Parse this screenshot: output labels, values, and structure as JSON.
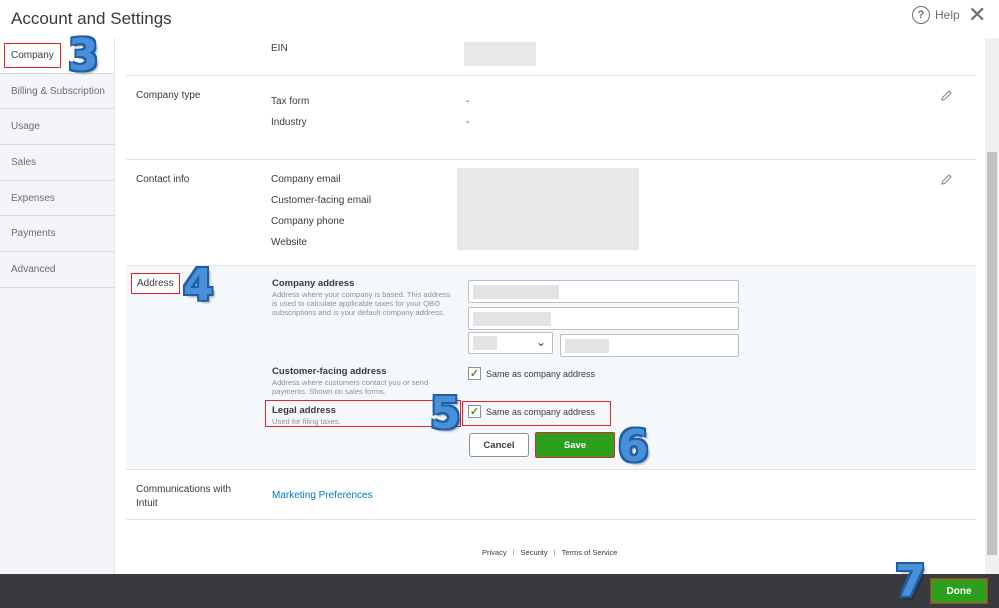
{
  "header": {
    "title": "Account and Settings",
    "help_label": "Help",
    "help_icon_glyph": "?",
    "close_glyph": "✕"
  },
  "sidebar": {
    "items": [
      {
        "label": "Company",
        "active": true
      },
      {
        "label": "Billing & Subscription"
      },
      {
        "label": "Usage"
      },
      {
        "label": "Sales"
      },
      {
        "label": "Expenses"
      },
      {
        "label": "Payments"
      },
      {
        "label": "Advanced"
      }
    ]
  },
  "company": {
    "ein_label": "EIN",
    "company_type": {
      "section_label": "Company type",
      "tax_form_label": "Tax form",
      "tax_form_value": "-",
      "industry_label": "Industry",
      "industry_value": "-"
    },
    "contact_info": {
      "section_label": "Contact info",
      "email_label": "Company email",
      "customer_email_label": "Customer-facing email",
      "phone_label": "Company phone",
      "website_label": "Website"
    },
    "address": {
      "section_label": "Address",
      "company_address_label": "Company address",
      "company_address_desc": "Address where your company is based. This address is used to calculate applicable taxes for your QBO subscriptions and is your default company address.",
      "customer_address_label": "Customer-facing address",
      "customer_address_desc": "Address where customers contact you or send payments. Shown on sales forms.",
      "customer_same_label": "Same as company address",
      "legal_address_label": "Legal address",
      "legal_address_desc": "Used for filing taxes.",
      "legal_same_label": "Same as company address",
      "cancel_label": "Cancel",
      "save_label": "Save"
    },
    "communications": {
      "section_label": "Communications with Intuit",
      "link_label": "Marketing Preferences"
    }
  },
  "footer": {
    "privacy": "Privacy",
    "security": "Security",
    "terms": "Terms of Service",
    "separator": "|"
  },
  "bottom": {
    "done_label": "Done"
  },
  "annotations": {
    "step3": "3",
    "step4": "4",
    "step5": "5",
    "step6": "6",
    "step7": "7"
  },
  "icons": {
    "edit": "pencil-icon",
    "check": "✓",
    "chevron": "⌄"
  },
  "colors": {
    "accent_green": "#2ca01c",
    "link_blue": "#0077c5",
    "annotation_red": "#e0262c",
    "annotation_blue": "#4a90d9"
  }
}
